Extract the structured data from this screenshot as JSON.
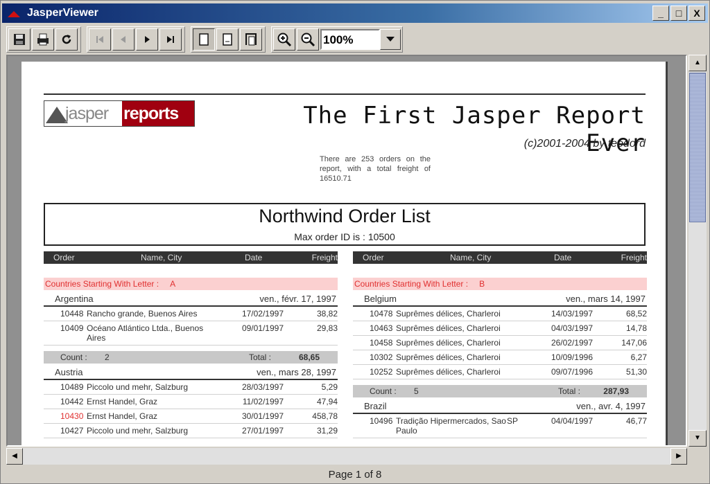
{
  "window": {
    "title": "JasperViewer",
    "controls": [
      "_",
      "□",
      "X"
    ]
  },
  "toolbar": {
    "zoom_value": "100%"
  },
  "status": {
    "page_label": "Page 1 of 8"
  },
  "report": {
    "logo_left": "jasper",
    "logo_right": "reports",
    "title": "The First Jasper Report Ever",
    "subtitle": "(c)2001-2004 by teodord",
    "note": "There are 253 orders on the report, with a total freight of 16510.71",
    "list_title": "Northwind Order List",
    "list_sub": "Max order ID is : 10500",
    "columns": {
      "order": "Order",
      "name_city": "Name, City",
      "date": "Date",
      "freight": "Freight"
    },
    "left": {
      "letter_label": "Countries Starting With Letter :",
      "letter": "A",
      "groups": [
        {
          "country": "Argentina",
          "country_right": "ven., févr. 17, 1997",
          "rows": [
            {
              "order": "10448",
              "name": "Rancho grande, Buenos Aires",
              "date": "17/02/1997",
              "freight": "38,82",
              "red": false
            },
            {
              "order": "10409",
              "name": "Océano Atlántico Ltda., Buenos Aires",
              "date": "09/01/1997",
              "freight": "29,83",
              "red": false
            }
          ],
          "count_label": "Count :",
          "count": "2",
          "total_label": "Total :",
          "total": "68,65"
        },
        {
          "country": "Austria",
          "country_right": "ven., mars 28, 1997",
          "rows": [
            {
              "order": "10489",
              "name": "Piccolo und mehr, Salzburg",
              "date": "28/03/1997",
              "freight": "5,29",
              "red": false
            },
            {
              "order": "10442",
              "name": "Ernst Handel, Graz",
              "date": "11/02/1997",
              "freight": "47,94",
              "red": false
            },
            {
              "order": "10430",
              "name": "Ernst Handel, Graz",
              "date": "30/01/1997",
              "freight": "458,78",
              "red": true
            },
            {
              "order": "10427",
              "name": "Piccolo und mehr, Salzburg",
              "date": "27/01/1997",
              "freight": "31,29",
              "red": false
            }
          ]
        }
      ]
    },
    "right": {
      "letter_label": "Countries Starting With Letter :",
      "letter": "B",
      "groups": [
        {
          "country": "Belgium",
          "country_right": "ven., mars 14, 1997",
          "rows": [
            {
              "order": "10478",
              "name": "Suprêmes délices, Charleroi",
              "date": "14/03/1997",
              "freight": "68,52",
              "red": false
            },
            {
              "order": "10463",
              "name": "Suprêmes délices, Charleroi",
              "date": "04/03/1997",
              "freight": "14,78",
              "red": false
            },
            {
              "order": "10458",
              "name": "Suprêmes délices, Charleroi",
              "date": "26/02/1997",
              "freight": "147,06",
              "red": false
            },
            {
              "order": "10302",
              "name": "Suprêmes délices, Charleroi",
              "date": "10/09/1996",
              "freight": "6,27",
              "red": false
            },
            {
              "order": "10252",
              "name": "Suprêmes délices, Charleroi",
              "date": "09/07/1996",
              "freight": "51,30",
              "red": false
            }
          ],
          "count_label": "Count :",
          "count": "5",
          "total_label": "Total :",
          "total": "287,93"
        },
        {
          "country": "Brazil",
          "country_right": "ven., avr. 4, 1997",
          "rows": [
            {
              "order": "10496",
              "name": "Tradição Hipermercados, Sao Paulo",
              "region": "SP",
              "date": "04/04/1997",
              "freight": "46,77",
              "red": false
            }
          ]
        }
      ]
    }
  }
}
